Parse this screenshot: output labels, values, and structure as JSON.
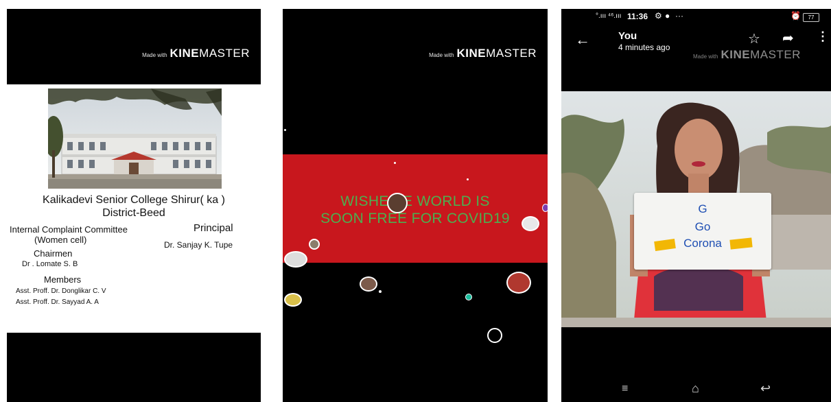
{
  "watermark": {
    "small": "Made with",
    "kine": "KINE",
    "master": "MASTER"
  },
  "panel1": {
    "college": "Kalikadevi Senior College Shirur( ka )",
    "district": "District-Beed",
    "committee_line1": "Internal Complaint Committee",
    "committee_line2": "(Women cell)",
    "principal_label": "Principal",
    "principal_name": "Dr. Sanjay K. Tupe",
    "chairmen_label": "Chairmen",
    "chairmen_name": "Dr . Lomate S. B",
    "members_label": "Members",
    "members": [
      "Asst. Proff. Dr. Donglikar  C. V",
      "Asst. Proff. Dr. Sayyad A. A"
    ]
  },
  "panel2": {
    "wish_line1": "WISHES    E WORLD IS",
    "wish_line2": "SOON FREE FOR COVID19"
  },
  "panel3": {
    "status": {
      "signal": "°.ııı ⁴⁶.ııı",
      "time": "11:36",
      "battery": "77"
    },
    "sender": "You",
    "time_ago": "4 minutes ago",
    "sign": {
      "line1": "G",
      "line2": "Go",
      "line3": "Corona"
    },
    "colors": {
      "shirt": "#e0323a",
      "sign_text": "#1f4fb3",
      "sign_tape": "#f2b705"
    }
  }
}
